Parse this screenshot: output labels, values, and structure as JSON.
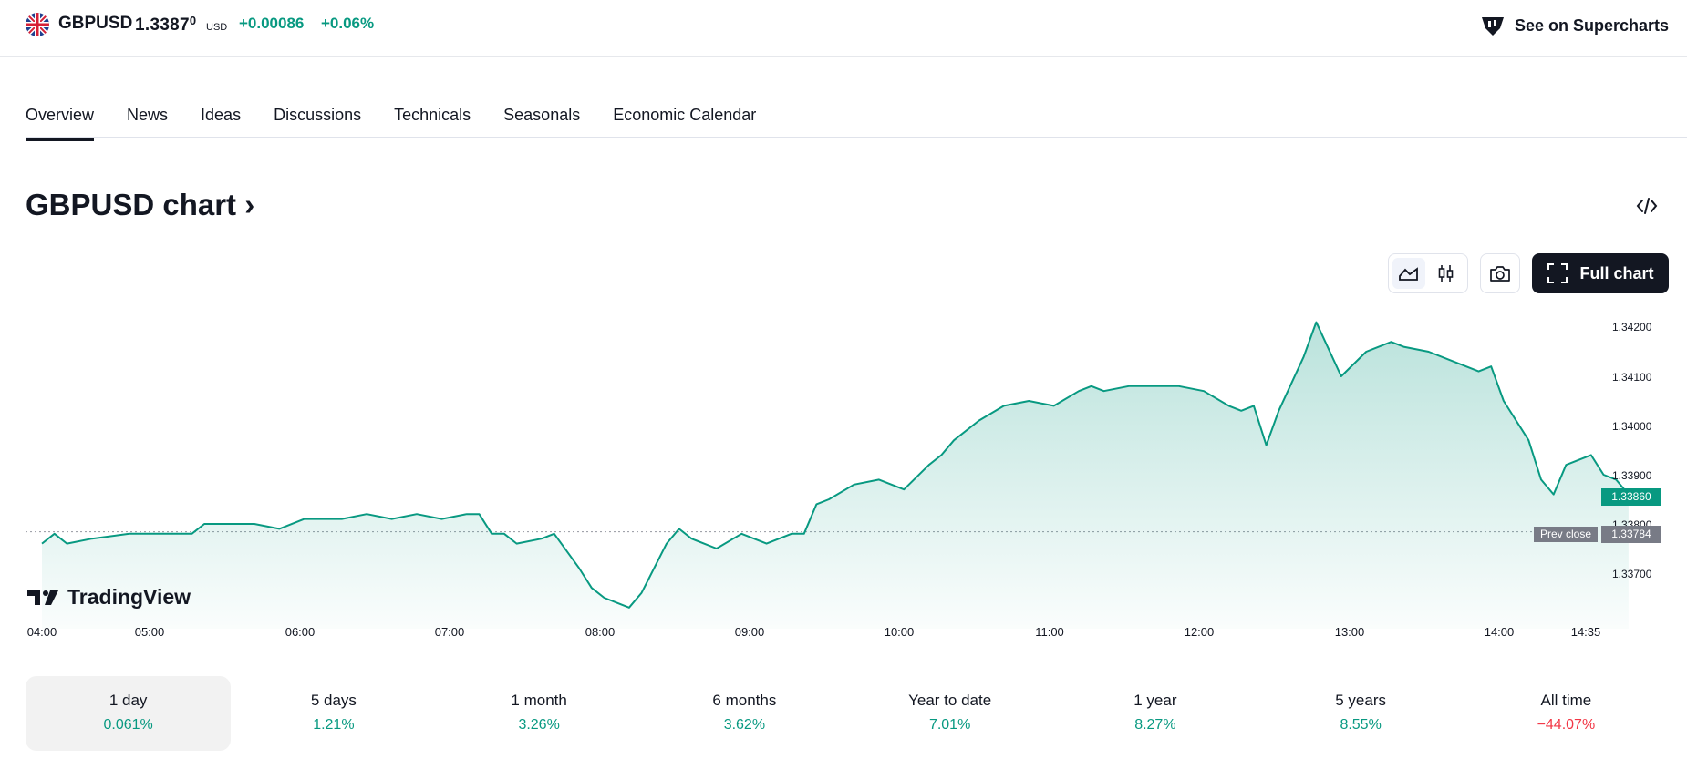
{
  "header": {
    "symbol": "GBPUSD",
    "price_main": "1.3387",
    "price_super": "0",
    "currency": "USD",
    "change": "+0.00086",
    "change_pct": "+0.06%",
    "supercharts_label": "See on Supercharts"
  },
  "tabs": [
    {
      "label": "Overview",
      "active": true
    },
    {
      "label": "News"
    },
    {
      "label": "Ideas"
    },
    {
      "label": "Discussions"
    },
    {
      "label": "Technicals"
    },
    {
      "label": "Seasonals"
    },
    {
      "label": "Economic Calendar"
    }
  ],
  "section_title": "GBPUSD chart",
  "toolbar": {
    "full_chart_label": "Full chart"
  },
  "chart_data": {
    "type": "area",
    "x_ticks": [
      "04:00",
      "05:00",
      "06:00",
      "07:00",
      "08:00",
      "09:00",
      "10:00",
      "11:00",
      "12:00",
      "13:00",
      "14:00",
      "14:35"
    ],
    "y_ticks": [
      "1.34200",
      "1.34100",
      "1.34000",
      "1.33900",
      "1.33800",
      "1.33700"
    ],
    "ylim": [
      1.3362,
      1.3422
    ],
    "points": [
      [
        "04:00",
        1.3376
      ],
      [
        "04:05",
        1.3378
      ],
      [
        "04:10",
        1.3376
      ],
      [
        "04:20",
        1.3377
      ],
      [
        "04:35",
        1.3378
      ],
      [
        "04:45",
        1.3378
      ],
      [
        "05:00",
        1.3378
      ],
      [
        "05:05",
        1.338
      ],
      [
        "05:15",
        1.338
      ],
      [
        "05:25",
        1.338
      ],
      [
        "05:35",
        1.3379
      ],
      [
        "05:45",
        1.3381
      ],
      [
        "06:00",
        1.3381
      ],
      [
        "06:10",
        1.3382
      ],
      [
        "06:20",
        1.3381
      ],
      [
        "06:30",
        1.3382
      ],
      [
        "06:40",
        1.3381
      ],
      [
        "06:50",
        1.3382
      ],
      [
        "06:55",
        1.3382
      ],
      [
        "07:00",
        1.3378
      ],
      [
        "07:05",
        1.3378
      ],
      [
        "07:10",
        1.3376
      ],
      [
        "07:20",
        1.3377
      ],
      [
        "07:25",
        1.3378
      ],
      [
        "07:35",
        1.3371
      ],
      [
        "07:40",
        1.3367
      ],
      [
        "07:45",
        1.3365
      ],
      [
        "07:50",
        1.3364
      ],
      [
        "07:55",
        1.3363
      ],
      [
        "08:00",
        1.3366
      ],
      [
        "08:10",
        1.3376
      ],
      [
        "08:15",
        1.3379
      ],
      [
        "08:20",
        1.3377
      ],
      [
        "08:30",
        1.3375
      ],
      [
        "08:40",
        1.3378
      ],
      [
        "08:50",
        1.3376
      ],
      [
        "08:55",
        1.3377
      ],
      [
        "09:00",
        1.3378
      ],
      [
        "09:05",
        1.3378
      ],
      [
        "09:10",
        1.3384
      ],
      [
        "09:15",
        1.3385
      ],
      [
        "09:25",
        1.3388
      ],
      [
        "09:35",
        1.3389
      ],
      [
        "09:45",
        1.3387
      ],
      [
        "09:55",
        1.3392
      ],
      [
        "10:00",
        1.3394
      ],
      [
        "10:05",
        1.3397
      ],
      [
        "10:15",
        1.3401
      ],
      [
        "10:25",
        1.3404
      ],
      [
        "10:35",
        1.3405
      ],
      [
        "10:45",
        1.3404
      ],
      [
        "10:55",
        1.3407
      ],
      [
        "11:00",
        1.3408
      ],
      [
        "11:05",
        1.3407
      ],
      [
        "11:15",
        1.3408
      ],
      [
        "11:25",
        1.3408
      ],
      [
        "11:35",
        1.3408
      ],
      [
        "11:45",
        1.3407
      ],
      [
        "11:55",
        1.3404
      ],
      [
        "12:00",
        1.3403
      ],
      [
        "12:05",
        1.3404
      ],
      [
        "12:10",
        1.3396
      ],
      [
        "12:15",
        1.3403
      ],
      [
        "12:25",
        1.3414
      ],
      [
        "12:30",
        1.3421
      ],
      [
        "12:40",
        1.341
      ],
      [
        "12:50",
        1.3415
      ],
      [
        "13:00",
        1.3417
      ],
      [
        "13:05",
        1.3416
      ],
      [
        "13:15",
        1.3415
      ],
      [
        "13:25",
        1.3413
      ],
      [
        "13:35",
        1.3411
      ],
      [
        "13:40",
        1.3412
      ],
      [
        "13:45",
        1.3405
      ],
      [
        "13:55",
        1.3397
      ],
      [
        "14:00",
        1.3389
      ],
      [
        "14:05",
        1.3386
      ],
      [
        "14:10",
        1.3392
      ],
      [
        "14:15",
        1.3393
      ],
      [
        "14:20",
        1.3394
      ],
      [
        "14:25",
        1.339
      ],
      [
        "14:30",
        1.3389
      ],
      [
        "14:35",
        1.3386
      ]
    ],
    "last_value": "1.33860",
    "prev_close_label": "Prev close",
    "prev_close": "1.33784",
    "colors": {
      "line": "#089981",
      "fill": "#089981",
      "prev_close_badge": "#787b86"
    }
  },
  "watermark": "TradingView",
  "periods": [
    {
      "label": "1 day",
      "value": "0.061%",
      "sign": "pos",
      "active": true
    },
    {
      "label": "5 days",
      "value": "1.21%",
      "sign": "pos"
    },
    {
      "label": "1 month",
      "value": "3.26%",
      "sign": "pos"
    },
    {
      "label": "6 months",
      "value": "3.62%",
      "sign": "pos"
    },
    {
      "label": "Year to date",
      "value": "7.01%",
      "sign": "pos"
    },
    {
      "label": "1 year",
      "value": "8.27%",
      "sign": "pos"
    },
    {
      "label": "5 years",
      "value": "8.55%",
      "sign": "pos"
    },
    {
      "label": "All time",
      "value": "−44.07%",
      "sign": "neg"
    }
  ]
}
